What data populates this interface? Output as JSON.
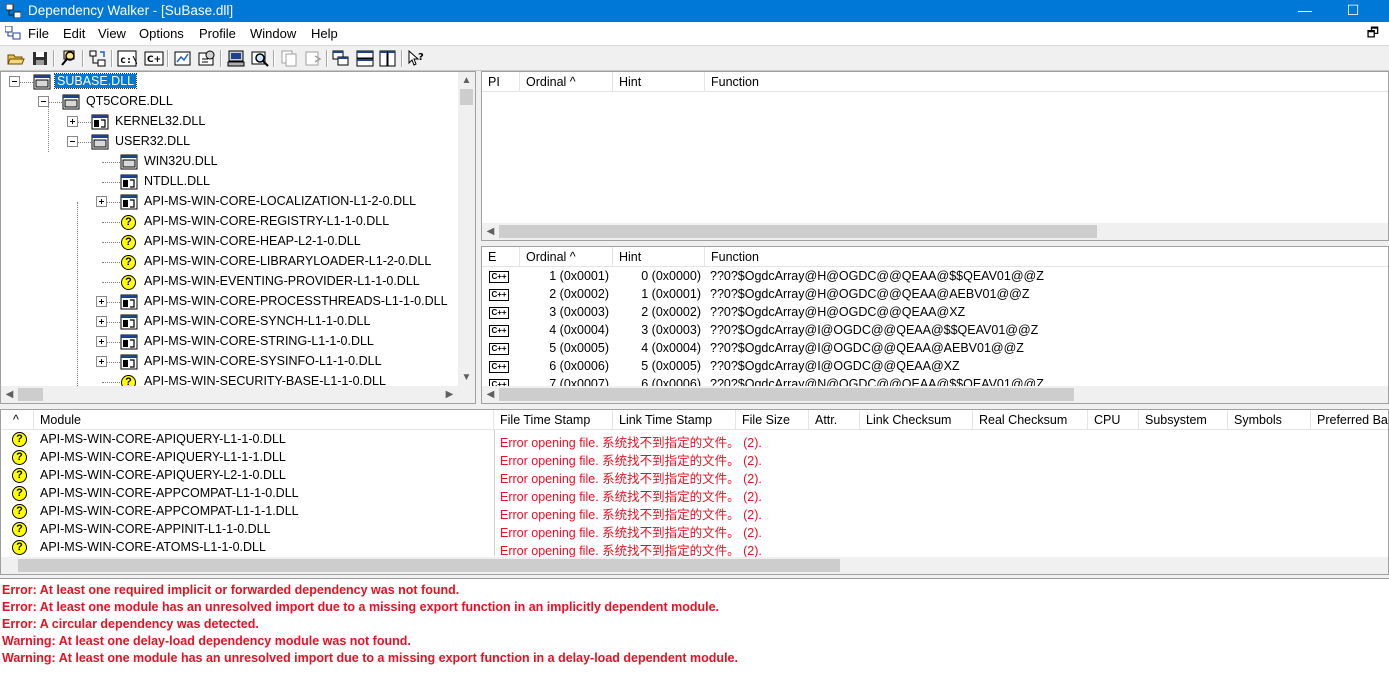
{
  "window": {
    "title": "Dependency Walker - [SuBase.dll]",
    "minimize": "—",
    "maximize": "☐"
  },
  "menu": {
    "items": [
      "File",
      "Edit",
      "View",
      "Options",
      "Profile",
      "Window",
      "Help"
    ],
    "restore": "🗗"
  },
  "toolbar": {
    "buttons": [
      "open-icon",
      "save-icon",
      "find-icon",
      "profile-icon",
      "full-paths-icon",
      "undecorate-cpp-icon",
      "auto-expand-icon",
      "properties-icon",
      "system-info-icon",
      "search-icon",
      "copy-icon",
      "refresh-icon",
      "cascade-icon",
      "tile-horizontal-icon",
      "tile-vertical-icon",
      "help-icon"
    ],
    "path_label": "c:\\",
    "cpp_label": "C+"
  },
  "tree": {
    "nodes": [
      {
        "label": "SUBASE.DLL",
        "level": 0,
        "expander": "minus",
        "icon": "module",
        "selected": true
      },
      {
        "label": "QT5CORE.DLL",
        "level": 1,
        "expander": "minus",
        "icon": "module"
      },
      {
        "label": "KERNEL32.DLL",
        "level": 2,
        "expander": "plus",
        "icon": "module-forward"
      },
      {
        "label": "USER32.DLL",
        "level": 2,
        "expander": "minus",
        "icon": "module"
      },
      {
        "label": "WIN32U.DLL",
        "level": 3,
        "expander": "none",
        "icon": "module"
      },
      {
        "label": "NTDLL.DLL",
        "level": 3,
        "expander": "none",
        "icon": "module-forward"
      },
      {
        "label": "API-MS-WIN-CORE-LOCALIZATION-L1-2-0.DLL",
        "level": 3,
        "expander": "plus",
        "icon": "module-forward"
      },
      {
        "label": "API-MS-WIN-CORE-REGISTRY-L1-1-0.DLL",
        "level": 3,
        "expander": "none",
        "icon": "missing"
      },
      {
        "label": "API-MS-WIN-CORE-HEAP-L2-1-0.DLL",
        "level": 3,
        "expander": "none",
        "icon": "missing"
      },
      {
        "label": "API-MS-WIN-CORE-LIBRARYLOADER-L1-2-0.DLL",
        "level": 3,
        "expander": "none",
        "icon": "missing"
      },
      {
        "label": "API-MS-WIN-EVENTING-PROVIDER-L1-1-0.DLL",
        "level": 3,
        "expander": "none",
        "icon": "missing"
      },
      {
        "label": "API-MS-WIN-CORE-PROCESSTHREADS-L1-1-0.DLL",
        "level": 3,
        "expander": "plus",
        "icon": "module-forward"
      },
      {
        "label": "API-MS-WIN-CORE-SYNCH-L1-1-0.DLL",
        "level": 3,
        "expander": "plus",
        "icon": "module-forward"
      },
      {
        "label": "API-MS-WIN-CORE-STRING-L1-1-0.DLL",
        "level": 3,
        "expander": "plus",
        "icon": "module-forward"
      },
      {
        "label": "API-MS-WIN-CORE-SYSINFO-L1-1-0.DLL",
        "level": 3,
        "expander": "plus",
        "icon": "module-forward"
      },
      {
        "label": "API-MS-WIN-SECURITY-BASE-L1-1-0.DLL",
        "level": 3,
        "expander": "none",
        "icon": "missing"
      }
    ]
  },
  "imports": {
    "headers": [
      "PI",
      "Ordinal ^",
      "Hint",
      "Function"
    ]
  },
  "exports": {
    "headers": [
      "E",
      "Ordinal ^",
      "Hint",
      "Function"
    ],
    "rows": [
      {
        "icon": "C++",
        "ordinal": "1 (0x0001)",
        "hint": "0 (0x0000)",
        "function": "??0?$OgdcArray@H@OGDC@@QEAA@$$QEAV01@@Z"
      },
      {
        "icon": "C++",
        "ordinal": "2 (0x0002)",
        "hint": "1 (0x0001)",
        "function": "??0?$OgdcArray@H@OGDC@@QEAA@AEBV01@@Z"
      },
      {
        "icon": "C++",
        "ordinal": "3 (0x0003)",
        "hint": "2 (0x0002)",
        "function": "??0?$OgdcArray@H@OGDC@@QEAA@XZ"
      },
      {
        "icon": "C++",
        "ordinal": "4 (0x0004)",
        "hint": "3 (0x0003)",
        "function": "??0?$OgdcArray@I@OGDC@@QEAA@$$QEAV01@@Z"
      },
      {
        "icon": "C++",
        "ordinal": "5 (0x0005)",
        "hint": "4 (0x0004)",
        "function": "??0?$OgdcArray@I@OGDC@@QEAA@AEBV01@@Z"
      },
      {
        "icon": "C++",
        "ordinal": "6 (0x0006)",
        "hint": "5 (0x0005)",
        "function": "??0?$OgdcArray@I@OGDC@@QEAA@XZ"
      },
      {
        "icon": "C++",
        "ordinal": "7 (0x0007)",
        "hint": "6 (0x0006)",
        "function": "??0?$OgdcArray@N@OGDC@@QEAA@$$QEAV01@@Z"
      }
    ]
  },
  "modules": {
    "headers": [
      "^",
      "Module",
      "File Time Stamp",
      "Link Time Stamp",
      "File Size",
      "Attr.",
      "Link Checksum",
      "Real Checksum",
      "CPU",
      "Subsystem",
      "Symbols",
      "Preferred Ba"
    ],
    "rows": [
      {
        "name": "API-MS-WIN-CORE-APIQUERY-L1-1-0.DLL",
        "error": "Error opening file. 系统找不到指定的文件。 (2)."
      },
      {
        "name": "API-MS-WIN-CORE-APIQUERY-L1-1-1.DLL",
        "error": "Error opening file. 系统找不到指定的文件。 (2)."
      },
      {
        "name": "API-MS-WIN-CORE-APIQUERY-L2-1-0.DLL",
        "error": "Error opening file. 系统找不到指定的文件。 (2)."
      },
      {
        "name": "API-MS-WIN-CORE-APPCOMPAT-L1-1-0.DLL",
        "error": "Error opening file. 系统找不到指定的文件。 (2)."
      },
      {
        "name": "API-MS-WIN-CORE-APPCOMPAT-L1-1-1.DLL",
        "error": "Error opening file. 系统找不到指定的文件。 (2)."
      },
      {
        "name": "API-MS-WIN-CORE-APPINIT-L1-1-0.DLL",
        "error": "Error opening file. 系统找不到指定的文件。 (2)."
      },
      {
        "name": "API-MS-WIN-CORE-ATOMS-L1-1-0.DLL",
        "error": "Error opening file. 系统找不到指定的文件。 (2)."
      }
    ]
  },
  "log": {
    "lines": [
      "Error: At least one required implicit or forwarded dependency was not found.",
      "Error: At least one module has an unresolved import due to a missing export function in an implicitly dependent module.",
      "Error: A circular dependency was detected.",
      "Warning: At least one delay-load dependency module was not found.",
      "Warning: At least one module has an unresolved import due to a missing export function in a delay-load dependent module."
    ]
  },
  "colors": {
    "titlebar": "#0078d7",
    "error_text": "#e81123",
    "selection": "#0078d7",
    "missing_icon": "#ffff00"
  }
}
